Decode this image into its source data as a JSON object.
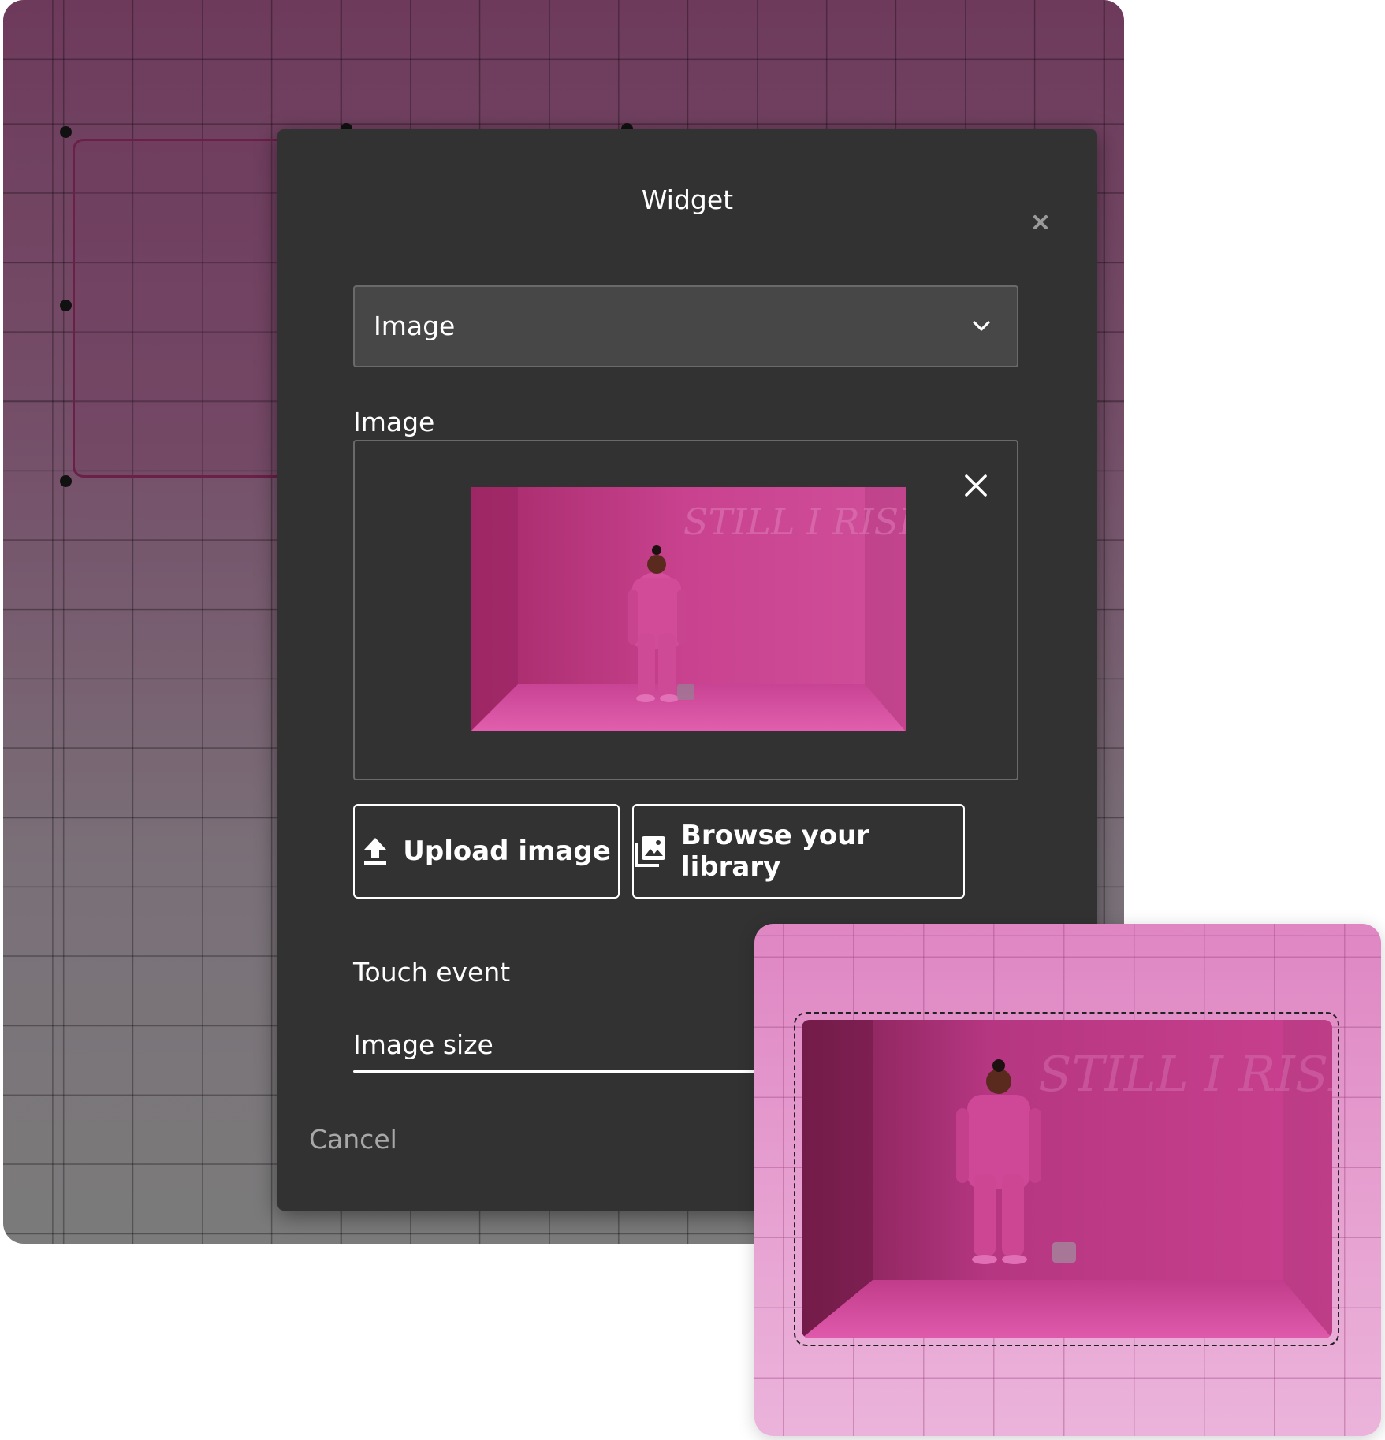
{
  "modal": {
    "title": "Widget",
    "close_icon": "close-icon",
    "select": {
      "value": "Image",
      "icon": "chevron-down-icon"
    },
    "image_label": "Image",
    "image_preview": {
      "wall_text": "STILL I RISE",
      "remove_icon": "close-icon"
    },
    "upload_button": {
      "label": "Upload image",
      "icon": "upload-icon"
    },
    "browse_button": {
      "label": "Browse your library",
      "icon": "library-images-icon"
    },
    "touch_event_label": "Touch event",
    "image_size_label": "Image size",
    "cancel_label": "Cancel"
  },
  "colors": {
    "modal_bg": "#323232",
    "select_bg": "#474747",
    "canvas_top": "#6e3a5c",
    "canvas_bottom": "#7b7b7b",
    "photo_pink": "#c9408f",
    "card_pink": "#e7a3d2"
  }
}
